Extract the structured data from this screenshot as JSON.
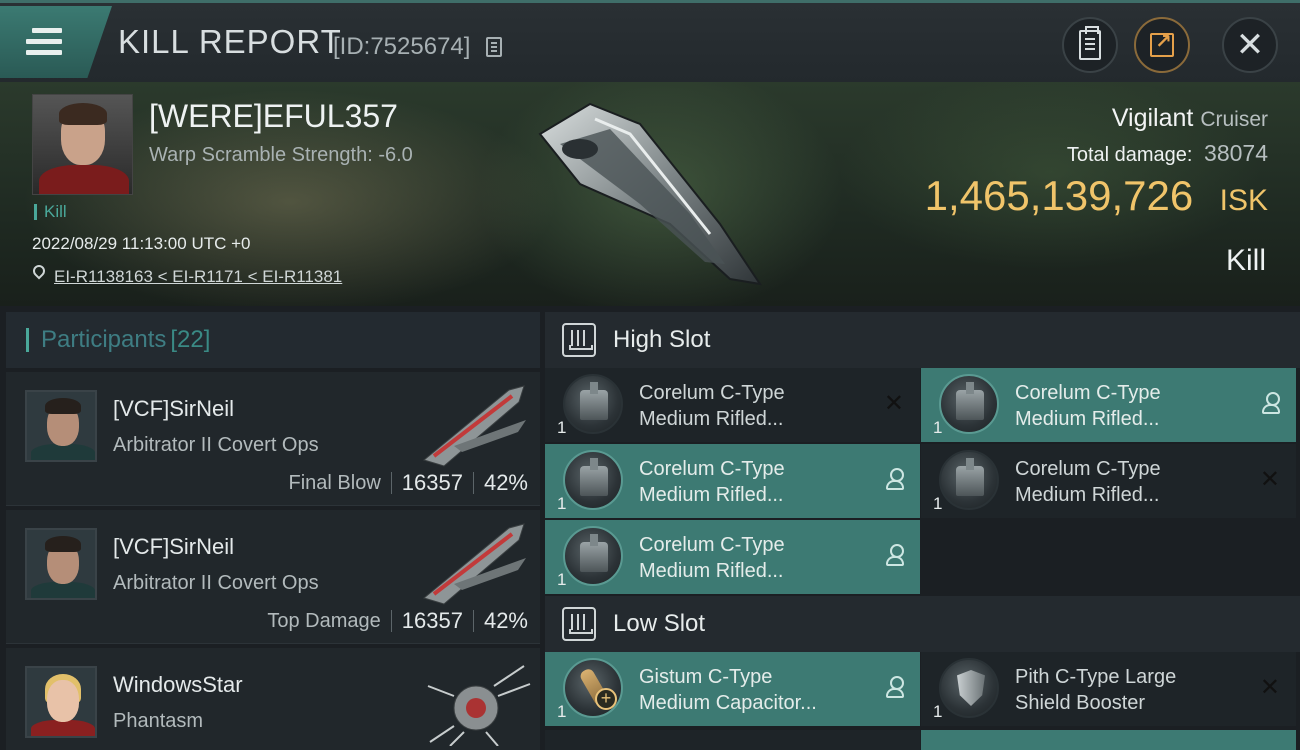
{
  "header": {
    "title": "KILL REPORT",
    "report_id": "[ID:7525674]"
  },
  "victim": {
    "name": "[WERE]EFUL357",
    "warp_scramble": "Warp Scramble Strength: -6.0",
    "tag": "Kill",
    "datetime": "2022/08/29 11:13:00 UTC +0",
    "location": "EI-R1138163 < EI-R1171 < EI-R11381",
    "ship_name": "Vigilant",
    "ship_class": "Cruiser",
    "total_damage_label": "Total damage:",
    "total_damage": "38074",
    "isk_value": "1,465,139,726",
    "isk_unit": "ISK",
    "result": "Kill"
  },
  "participants": {
    "label": "Participants",
    "count": "[22]",
    "items": [
      {
        "name": "[VCF]SirNeil",
        "ship": "Arbitrator II Covert Ops",
        "role": "Final Blow",
        "damage": "16357",
        "percent": "42%"
      },
      {
        "name": "[VCF]SirNeil",
        "ship": "Arbitrator II Covert Ops",
        "role": "Top Damage",
        "damage": "16357",
        "percent": "42%"
      },
      {
        "name": "WindowsStar",
        "ship": "Phantasm"
      }
    ]
  },
  "slots": {
    "high": {
      "title": "High Slot",
      "modules": [
        {
          "line1": "Corelum C-Type",
          "line2": "Medium Rifled...",
          "qty": "1",
          "status": "destroyed"
        },
        {
          "line1": "Corelum C-Type",
          "line2": "Medium Rifled...",
          "qty": "1",
          "status": "dropped"
        },
        {
          "line1": "Corelum C-Type",
          "line2": "Medium Rifled...",
          "qty": "1",
          "status": "dropped"
        },
        {
          "line1": "Corelum C-Type",
          "line2": "Medium Rifled...",
          "qty": "1",
          "status": "destroyed"
        },
        {
          "line1": "Corelum C-Type",
          "line2": "Medium Rifled...",
          "qty": "1",
          "status": "dropped"
        }
      ]
    },
    "low": {
      "title": "Low Slot",
      "modules": [
        {
          "line1": "Gistum C-Type",
          "line2": "Medium Capacitor...",
          "qty": "1",
          "status": "dropped"
        },
        {
          "line1": "Pith C-Type Large",
          "line2": "Shield Booster",
          "qty": "1",
          "status": "destroyed"
        }
      ]
    }
  },
  "colors": {
    "accent_teal": "#3d7a73",
    "isk_gold": "#f0c46a",
    "header_bg": "#242a2f"
  },
  "icons": [
    "menu-icon",
    "copy-icon",
    "clipboard-icon",
    "share-icon",
    "close-icon",
    "location-pin-icon",
    "high-slot-icon",
    "low-slot-icon",
    "person-icon",
    "x-icon"
  ]
}
